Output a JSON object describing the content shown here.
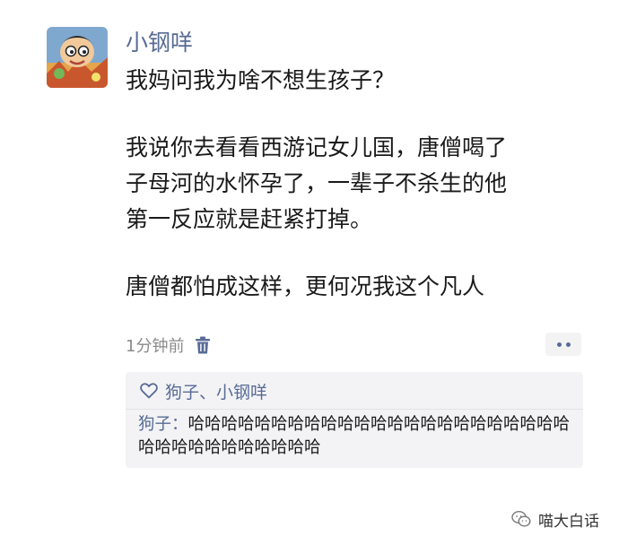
{
  "post": {
    "author": "小钢咩",
    "paragraphs": [
      "我妈问我为啥不想生孩子？",
      "我说你去看看西游记女儿国，唐僧喝了\n子母河的水怀孕了，一辈子不杀生的他\n第一反应就是赶紧打掉。",
      "唐僧都怕成这样，更何况我这个凡人"
    ],
    "timestamp": "1分钟前"
  },
  "interactions": {
    "likes": "狗子、小钢咩",
    "comment": {
      "author": "狗子",
      "separator": "：",
      "text": "哈哈哈哈哈哈哈哈哈哈哈哈哈哈哈哈哈哈哈哈哈哈哈哈哈哈哈哈哈哈哈哈哈哈"
    }
  },
  "watermark": {
    "text": "喵大白话"
  },
  "colors": {
    "name_link": "#586b95",
    "body_text": "#1a1a1a",
    "meta_text": "#8a8a8a",
    "panel_bg": "#f3f3f5"
  },
  "icons": [
    "avatar-cartoon",
    "trash-icon",
    "more-dots-icon",
    "heart-icon",
    "wechat-icon"
  ]
}
